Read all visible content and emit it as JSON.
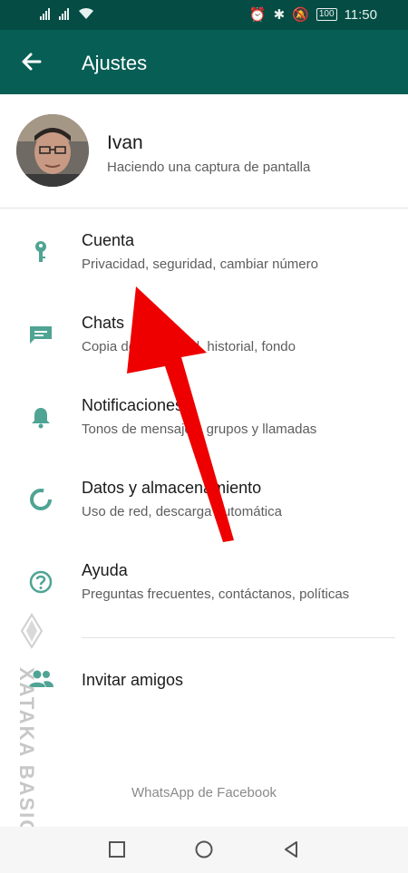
{
  "status_bar": {
    "time": "11:50",
    "battery": "100"
  },
  "app_bar": {
    "title": "Ajustes"
  },
  "profile": {
    "name": "Ivan",
    "status": "Haciendo una captura de pantalla"
  },
  "settings": [
    {
      "title": "Cuenta",
      "subtitle": "Privacidad, seguridad, cambiar número",
      "icon": "key-icon"
    },
    {
      "title": "Chats",
      "subtitle": "Copia de seguridad, historial, fondo",
      "icon": "chat-icon"
    },
    {
      "title": "Notificaciones",
      "subtitle": "Tonos de mensajes, grupos y llamadas",
      "icon": "bell-icon"
    },
    {
      "title": "Datos y almacenamiento",
      "subtitle": "Uso de red, descarga automática",
      "icon": "data-usage-icon"
    },
    {
      "title": "Ayuda",
      "subtitle": "Preguntas frecuentes, contáctanos, políticas",
      "icon": "help-icon"
    }
  ],
  "invite": {
    "title": "Invitar amigos",
    "icon": "people-icon"
  },
  "footer": {
    "text": "WhatsApp de Facebook"
  },
  "watermark": {
    "text": "XATAKA BASICS"
  },
  "colors": {
    "header": "#075e54",
    "status_bar": "#054d44",
    "icon_teal": "#4fa494",
    "arrow_red": "#ee0000"
  }
}
